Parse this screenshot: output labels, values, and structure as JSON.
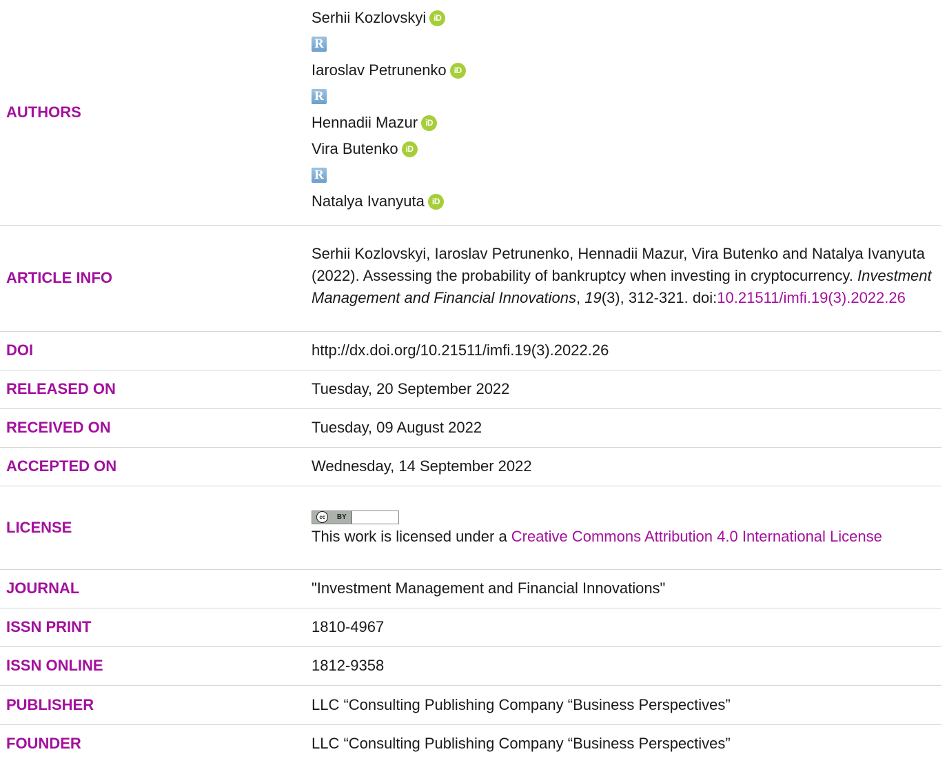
{
  "authors": {
    "label": "AUTHORS",
    "list": [
      {
        "name": "Serhii Kozlovskyi",
        "orcid_mark": "iD",
        "researcherid_mark": "R"
      },
      {
        "name": "Iaroslav Petrunenko",
        "orcid_mark": "iD",
        "researcherid_mark": "R"
      },
      {
        "name": "Hennadii Mazur",
        "orcid_mark": "iD"
      },
      {
        "name": "Vira Butenko",
        "orcid_mark": "iD",
        "researcherid_mark": "R"
      },
      {
        "name": "Natalya Ivanyuta",
        "orcid_mark": "iD"
      }
    ]
  },
  "article_info": {
    "label": "ARTICLE INFO",
    "citation_prefix": "Serhii Kozlovskyi, Iaroslav Petrunenko, Hennadii Mazur, Vira Butenko and Natalya Ivanyuta (2022). Assessing the probability of bankruptcy when investing in cryptocurrency. ",
    "journal_italic": "Investment Management and Financial Innovations",
    "sep1": ", ",
    "volume_italic": "19",
    "issue_pages": "(3), 312-321. doi:",
    "doi_link": "10.21511/imfi.19(3).2022.26"
  },
  "doi": {
    "label": "DOI",
    "value": "http://dx.doi.org/10.21511/imfi.19(3).2022.26"
  },
  "released": {
    "label": "RELEASED ON",
    "value": "Tuesday, 20 September 2022"
  },
  "received": {
    "label": "RECEIVED ON",
    "value": "Tuesday, 09 August 2022"
  },
  "accepted": {
    "label": "ACCEPTED ON",
    "value": "Wednesday, 14 September 2022"
  },
  "license": {
    "label": "LICENSE",
    "badge_cc": "cc",
    "badge_by": "BY",
    "text_prefix": "This work is licensed under a ",
    "link_text": "Creative Commons Attribution 4.0 International License"
  },
  "journal": {
    "label": "JOURNAL",
    "value": "\"Investment Management and Financial Innovations\""
  },
  "issn_print": {
    "label": "ISSN PRINT",
    "value": "1810-4967"
  },
  "issn_online": {
    "label": "ISSN ONLINE",
    "value": "1812-9358"
  },
  "publisher": {
    "label": "PUBLISHER",
    "value": "LLC “Consulting Publishing Company “Business Perspectives”"
  },
  "founder": {
    "label": "FOUNDER",
    "value": "LLC “Consulting Publishing Company “Business Perspectives”"
  },
  "colors": {
    "label": "#a3109e",
    "link": "#a3109e",
    "orcid": "#a6ce39",
    "researcherid": "#7ea9d1",
    "divider": "#d6d6d6"
  }
}
